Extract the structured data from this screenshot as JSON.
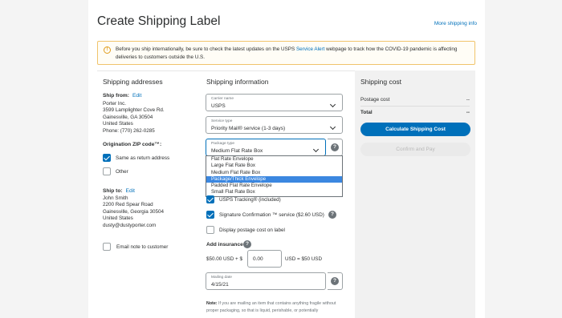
{
  "header": {
    "title": "Create Shipping Label",
    "more_info": "More shipping info"
  },
  "alert": {
    "icon": "info-circle-icon",
    "text_before": "Before you ship internationally, be sure to check the latest updates on the USPS ",
    "link": "Service Alert",
    "text_after": " webpage to track how the COVID-19 pandemic is affecting deliveries to customers outside the U.S."
  },
  "addresses": {
    "heading": "Shipping addresses",
    "ship_from_label": "Ship from:",
    "edit": "Edit",
    "from_lines": [
      "Porter Inc.",
      "3599 Lamplighter Cove Rd.",
      "Gainesville, GA 30504",
      "United States",
      "Phone: (770) 262-0285"
    ],
    "origin_zip_label": "Origination ZIP code™:",
    "same_as_return": "Same as return address",
    "other": "Other",
    "ship_to_label": "Ship to:",
    "to_lines": [
      "John Smith",
      "2200 Red Spear Road",
      "Gainesville, Georgia 30504",
      "United States",
      "dusty@dustyporter.com"
    ],
    "email_note": "Email note to customer"
  },
  "shipping_info": {
    "heading": "Shipping information",
    "carrier_label": "Carrier name",
    "carrier_value": "USPS",
    "service_label": "Service type",
    "service_value": "Priority Mail® service (1-3 days)",
    "package_label": "Package type",
    "package_value": "Medium Flat Rate Box",
    "package_options": [
      "Flat Rate Envelope",
      "Large Flat Rate Box",
      "Medium Flat Rate Box",
      "Package/Thick Envelope",
      "Padded Flat Rate Envelope",
      "Small Flat Rate Box"
    ],
    "highlighted_option": "Package/Thick Envelope",
    "tracking": "USPS Tracking® (included)",
    "signature": "Signature Confirmation ™ service ($2.60 USD)",
    "display_postage": "Display postage cost on label",
    "add_insurance": "Add insurance",
    "insurance_prefix": "$50.00 USD + $",
    "insurance_value": "0.00",
    "insurance_suffix": "USD = $50 USD",
    "mailing_date_label": "Mailing date",
    "mailing_date_value": "4/15/21",
    "note_bold": "Note:",
    "note_text": " If you are mailing an item that contains anything fragile without proper packaging, so that is liquid, perishable, or potentially"
  },
  "cost": {
    "heading": "Shipping cost",
    "postage_label": "Postage cost",
    "postage_value": "--",
    "total_label": "Total",
    "total_value": "--",
    "calc_button": "Calculate Shipping Cost",
    "confirm_button": "Confirm and Pay"
  },
  "colors": {
    "accent": "#0070ba",
    "alert_border": "#f0c46b",
    "highlight": "#3b87e0"
  }
}
